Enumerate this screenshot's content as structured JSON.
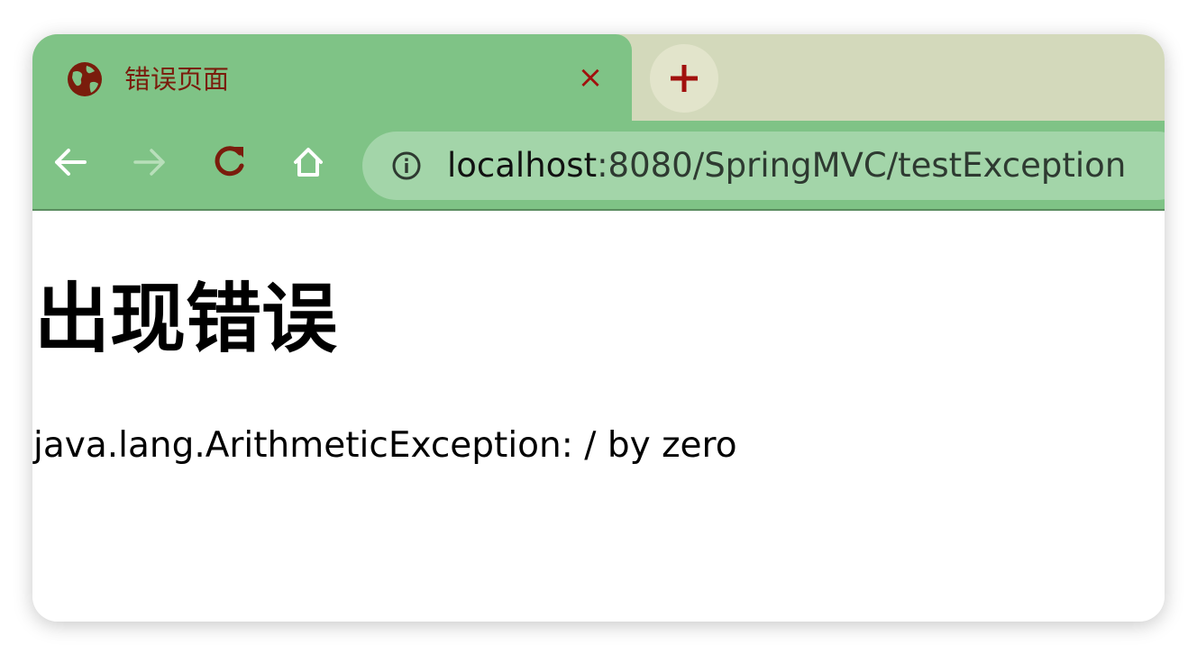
{
  "browser": {
    "tab": {
      "title": "错误页面",
      "close_glyph": "×",
      "favicon": "globe-icon"
    },
    "new_tab": {
      "icon": "plus-icon"
    },
    "toolbar": {
      "back": "arrow-left-icon",
      "forward": "arrow-right-icon",
      "reload": "reload-icon",
      "home": "home-icon"
    },
    "address_bar": {
      "security_icon": "info-icon",
      "host": "localhost",
      "rest": ":8080/SpringMVC/testException"
    },
    "colors": {
      "tab_active": "#7fc386",
      "tabstrip": "#d3d9bb",
      "omnibox": "#a3d5a9",
      "accent": "#a1100d",
      "tab_text": "#7a1c0c"
    }
  },
  "page": {
    "heading": "出现错误",
    "message": "java.lang.ArithmeticException: / by zero"
  }
}
